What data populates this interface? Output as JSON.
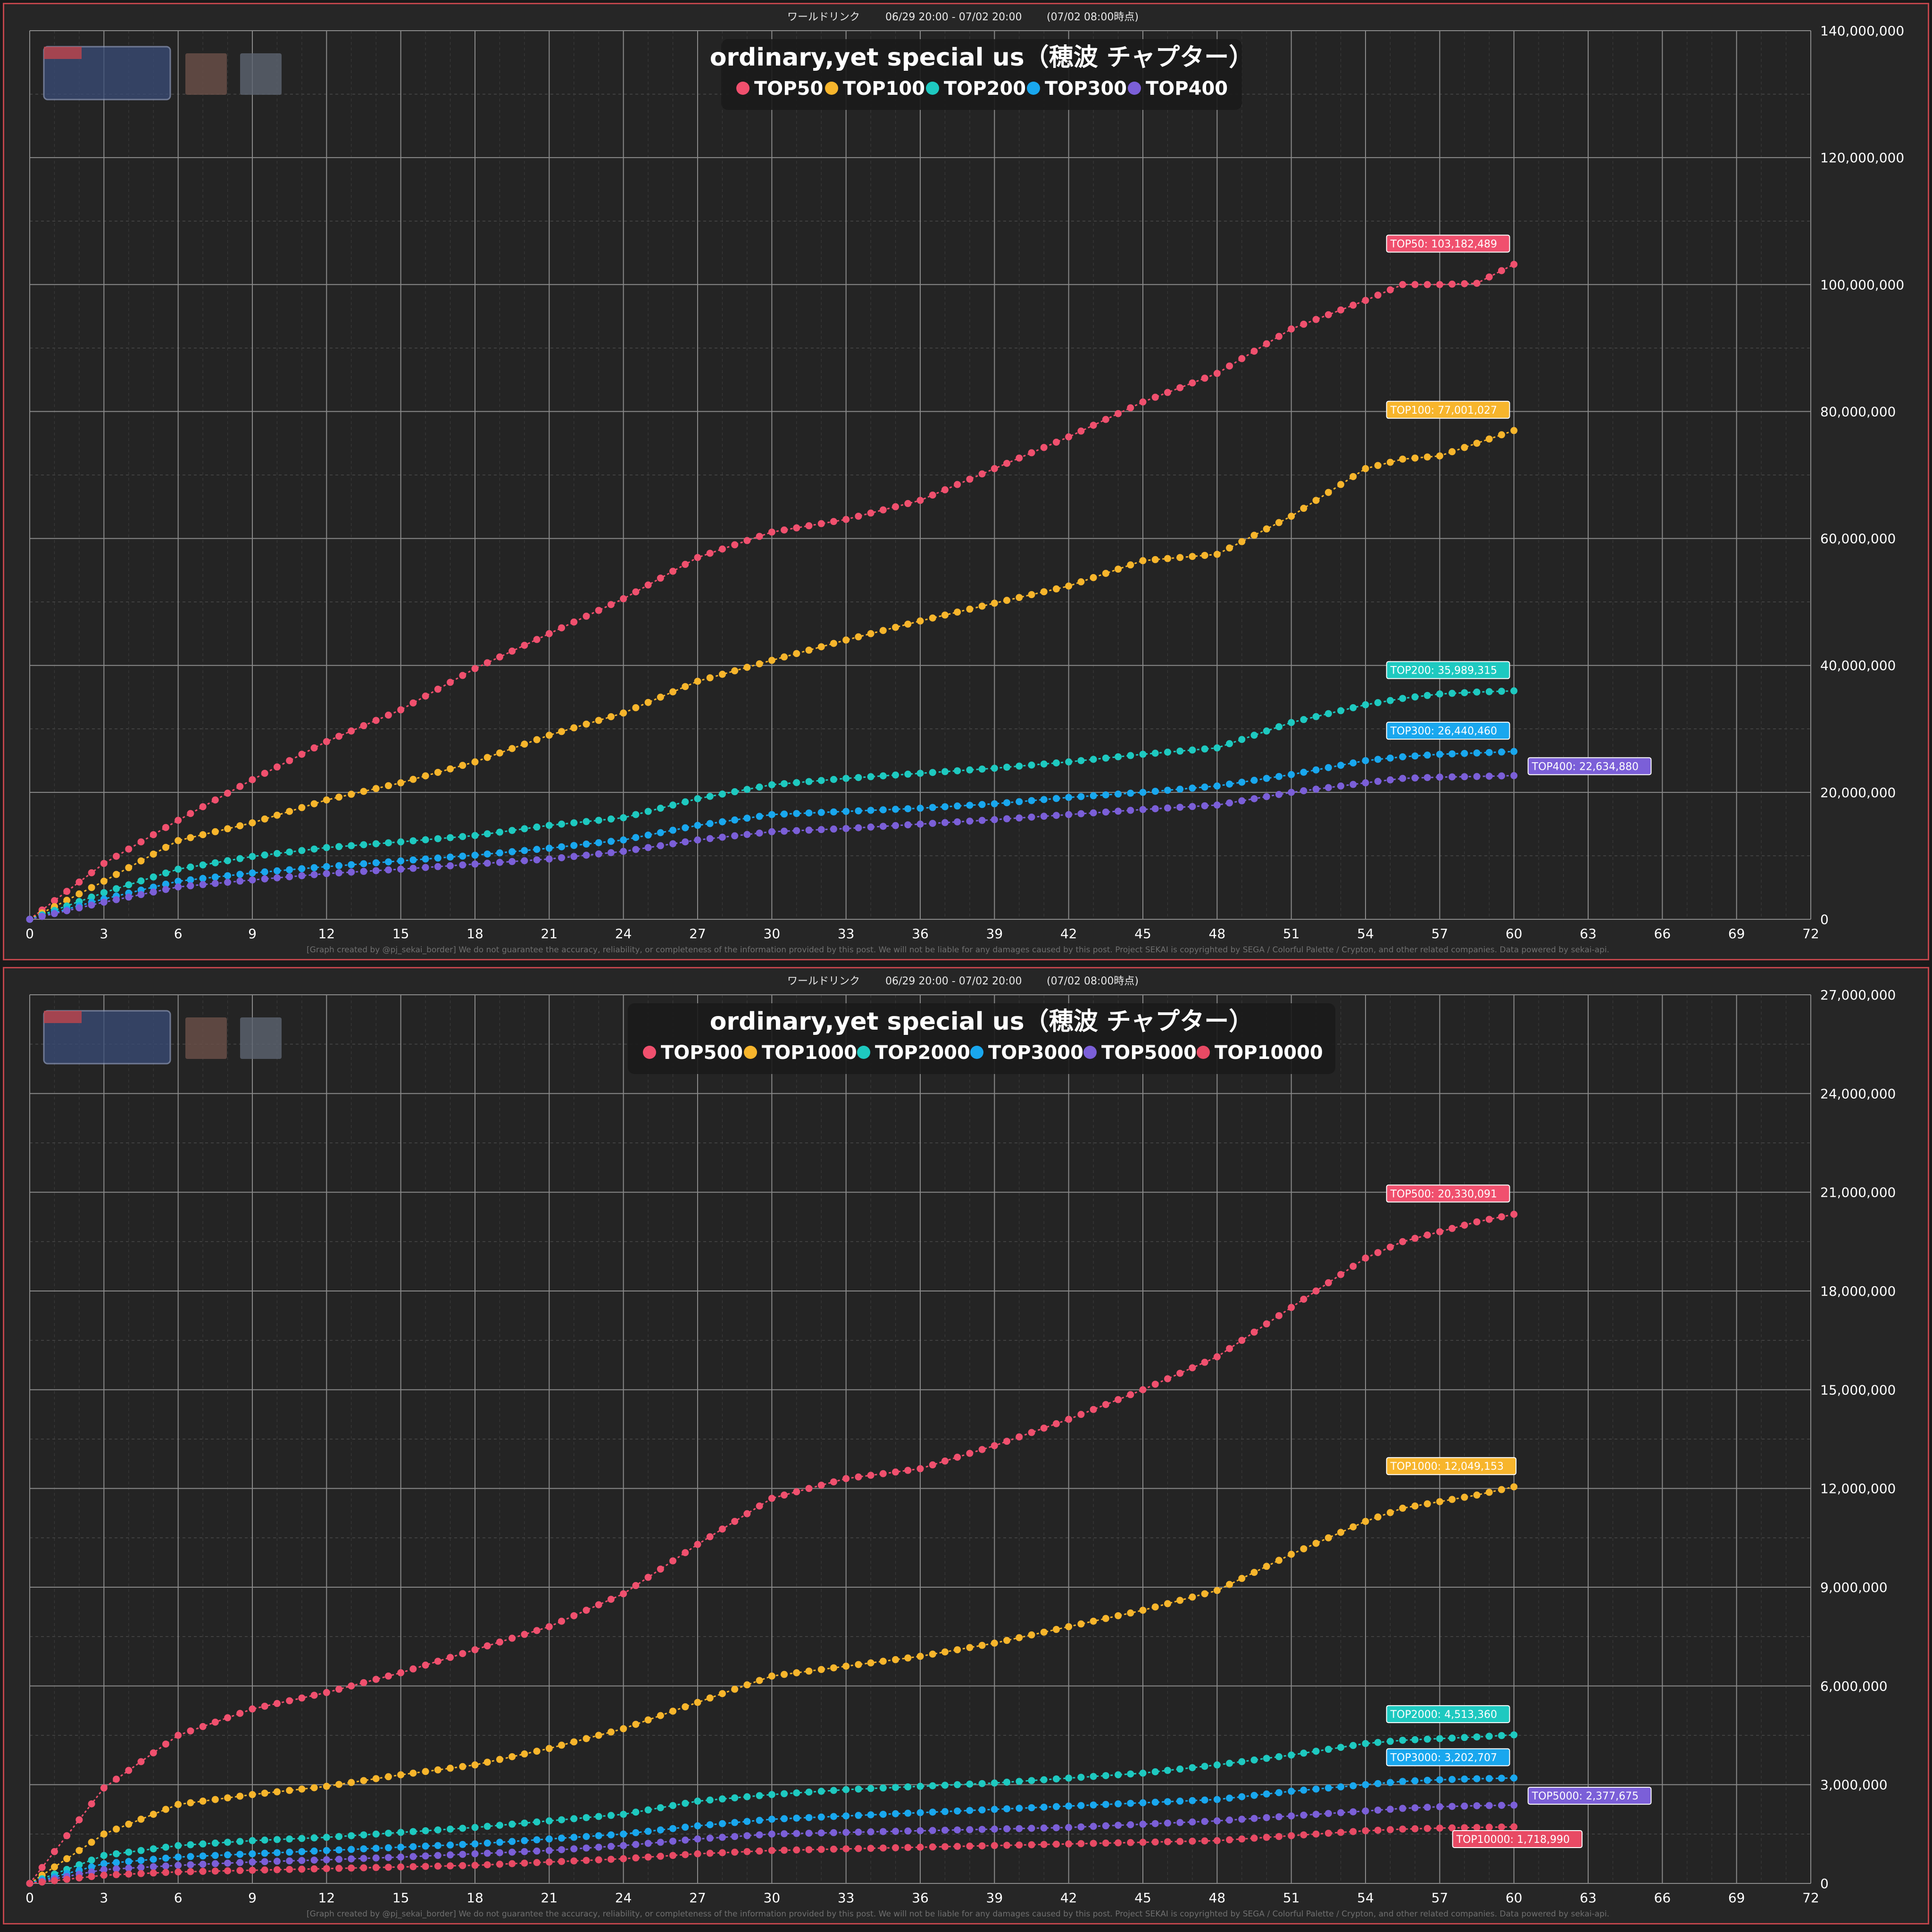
{
  "chart_data": [
    {
      "type": "line",
      "header": {
        "event": "ワールドリンク",
        "period": "06/29 20:00 - 07/02 20:00",
        "as_of": "(07/02 08:00時点)"
      },
      "title": "ordinary,yet special us（穂波 チャプター）",
      "xlim": [
        0,
        72
      ],
      "ylim": [
        0,
        140000000
      ],
      "xticks": [
        0,
        3,
        6,
        9,
        12,
        15,
        18,
        21,
        24,
        27,
        30,
        33,
        36,
        39,
        42,
        45,
        48,
        51,
        54,
        57,
        60,
        63,
        66,
        69,
        72
      ],
      "yticks": [
        "0",
        "20,000,000",
        "40,000,000",
        "60,000,000",
        "80,000,000",
        "100,000,000",
        "120,000,000",
        "140,000,000"
      ],
      "ytick_values": [
        0,
        20000000,
        40000000,
        60000000,
        80000000,
        100000000,
        120000000,
        140000000
      ],
      "grid": true,
      "legend_position": "top-center",
      "footer": "[Graph created by @pj_sekai_border]  We do not guarantee the accuracy, reliability, or completeness of the information provided by this post. We will not be liable for any damages caused by this post. Project SEKAI is copyrighted by SEGA / Colorful Palette / Crypton, and other related companies. Data powered by sekai-api.",
      "x": [
        0,
        3,
        6,
        9,
        12,
        15,
        18,
        21,
        24,
        27,
        30,
        33,
        36,
        39,
        42,
        45,
        48,
        51,
        54,
        55.5,
        57,
        58.5,
        60
      ],
      "series": [
        {
          "name": "TOP50",
          "color": "#f0506e",
          "label": "TOP50: 103,182,489",
          "values": [
            0,
            8800000,
            15600000,
            22000000,
            28000000,
            33000000,
            39500000,
            45000000,
            50500000,
            57000000,
            61000000,
            63000000,
            66000000,
            71000000,
            76000000,
            81500000,
            86000000,
            93000000,
            97500000,
            100000000,
            100000000,
            100200000,
            103182489
          ]
        },
        {
          "name": "TOP100",
          "color": "#f7b52c",
          "label": "TOP100: 77,001,027",
          "values": [
            0,
            6000000,
            12400000,
            15200000,
            18800000,
            21500000,
            24800000,
            29000000,
            32500000,
            37500000,
            40800000,
            44000000,
            47000000,
            49800000,
            52500000,
            56500000,
            57500000,
            63500000,
            71000000,
            72500000,
            73000000,
            75000000,
            77001027
          ]
        },
        {
          "name": "TOP200",
          "color": "#1ec9c0",
          "label": "TOP200: 35,989,315",
          "values": [
            0,
            4200000,
            7900000,
            9900000,
            11300000,
            12200000,
            13200000,
            14800000,
            16000000,
            19000000,
            21200000,
            22200000,
            23000000,
            23800000,
            24800000,
            26000000,
            27000000,
            31000000,
            33800000,
            34800000,
            35500000,
            35800000,
            35989315
          ]
        },
        {
          "name": "TOP300",
          "color": "#19a7ee",
          "label": "TOP300: 26,440,460",
          "values": [
            0,
            3200000,
            6000000,
            7300000,
            8300000,
            9200000,
            10100000,
            11200000,
            12500000,
            14800000,
            16500000,
            17000000,
            17500000,
            18200000,
            19200000,
            20000000,
            21000000,
            22800000,
            25000000,
            25600000,
            26000000,
            26200000,
            26440460
          ]
        },
        {
          "name": "TOP400",
          "color": "#7b5fd8",
          "label": "TOP400: 22,634,880",
          "values": [
            0,
            2700000,
            5100000,
            6200000,
            7200000,
            7900000,
            8700000,
            9500000,
            10700000,
            12500000,
            13800000,
            14300000,
            15000000,
            15700000,
            16500000,
            17300000,
            18000000,
            20000000,
            21500000,
            22200000,
            22400000,
            22500000,
            22634880
          ]
        }
      ]
    },
    {
      "type": "line",
      "header": {
        "event": "ワールドリンク",
        "period": "06/29 20:00 - 07/02 20:00",
        "as_of": "(07/02 08:00時点)"
      },
      "title": "ordinary,yet special us（穂波 チャプター）",
      "xlim": [
        0,
        72
      ],
      "ylim": [
        0,
        27000000
      ],
      "xticks": [
        0,
        3,
        6,
        9,
        12,
        15,
        18,
        21,
        24,
        27,
        30,
        33,
        36,
        39,
        42,
        45,
        48,
        51,
        54,
        57,
        60,
        63,
        66,
        69,
        72
      ],
      "yticks": [
        "0",
        "3,000,000",
        "6,000,000",
        "9,000,000",
        "12,000,000",
        "15,000,000",
        "18,000,000",
        "21,000,000",
        "24,000,000",
        "27,000,000"
      ],
      "ytick_values": [
        0,
        3000000,
        6000000,
        9000000,
        12000000,
        15000000,
        18000000,
        21000000,
        24000000,
        27000000
      ],
      "grid": true,
      "legend_position": "top-center",
      "footer": "[Graph created by @pj_sekai_border]  We do not guarantee the accuracy, reliability, or completeness of the information provided by this post. We will not be liable for any damages caused by this post. Project SEKAI is copyrighted by SEGA / Colorful Palette / Crypton, and other related companies. Data powered by sekai-api.",
      "x": [
        0,
        3,
        6,
        9,
        12,
        15,
        18,
        21,
        24,
        27,
        30,
        33,
        36,
        39,
        42,
        45,
        48,
        51,
        54,
        55.5,
        57,
        58.5,
        60
      ],
      "series": [
        {
          "name": "TOP500",
          "color": "#f0506e",
          "label": "TOP500: 20,330,091",
          "values": [
            0,
            2900000,
            4500000,
            5300000,
            5800000,
            6400000,
            7100000,
            7800000,
            8800000,
            10300000,
            11700000,
            12300000,
            12600000,
            13300000,
            14100000,
            15000000,
            16000000,
            17500000,
            19000000,
            19500000,
            19800000,
            20100000,
            20330091
          ]
        },
        {
          "name": "TOP1000",
          "color": "#f7b52c",
          "label": "TOP1000: 12,049,153",
          "values": [
            0,
            1500000,
            2400000,
            2700000,
            2950000,
            3300000,
            3600000,
            4100000,
            4700000,
            5500000,
            6300000,
            6600000,
            6900000,
            7300000,
            7800000,
            8300000,
            8900000,
            10000000,
            11000000,
            11400000,
            11600000,
            11800000,
            12049153
          ]
        },
        {
          "name": "TOP2000",
          "color": "#1ec9c0",
          "label": "TOP2000: 4,513,360",
          "values": [
            0,
            850000,
            1150000,
            1300000,
            1400000,
            1550000,
            1700000,
            1900000,
            2100000,
            2500000,
            2700000,
            2850000,
            2950000,
            3050000,
            3200000,
            3350000,
            3600000,
            3900000,
            4250000,
            4350000,
            4400000,
            4450000,
            4513360
          ]
        },
        {
          "name": "TOP3000",
          "color": "#19a7ee",
          "label": "TOP3000: 3,202,707",
          "values": [
            0,
            600000,
            800000,
            900000,
            1000000,
            1100000,
            1200000,
            1350000,
            1500000,
            1750000,
            1950000,
            2050000,
            2150000,
            2250000,
            2350000,
            2450000,
            2550000,
            2800000,
            3000000,
            3100000,
            3150000,
            3180000,
            3202707
          ]
        },
        {
          "name": "TOP5000",
          "color": "#7b5fd8",
          "label": "TOP5000: 2,377,675",
          "values": [
            0,
            420000,
            550000,
            650000,
            720000,
            800000,
            900000,
            1000000,
            1150000,
            1350000,
            1500000,
            1550000,
            1600000,
            1650000,
            1700000,
            1800000,
            1900000,
            2050000,
            2200000,
            2280000,
            2330000,
            2360000,
            2377675
          ]
        },
        {
          "name": "TOP10000",
          "color": "#e84a64",
          "label": "TOP10000: 1,718,990",
          "values": [
            0,
            250000,
            350000,
            400000,
            450000,
            500000,
            550000,
            650000,
            750000,
            900000,
            1000000,
            1050000,
            1100000,
            1150000,
            1200000,
            1250000,
            1300000,
            1450000,
            1600000,
            1650000,
            1680000,
            1700000,
            1718990
          ]
        }
      ]
    }
  ]
}
